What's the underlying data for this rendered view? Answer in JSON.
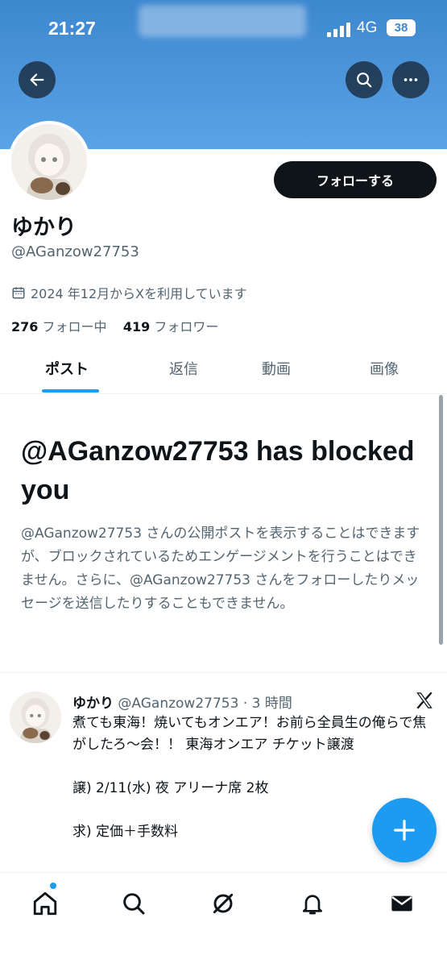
{
  "status_bar": {
    "time": "21:27",
    "network": "4G",
    "battery": "38"
  },
  "header": {
    "back_icon": "arrow-left-icon",
    "search_icon": "search-icon",
    "more_icon": "more-icon"
  },
  "profile": {
    "name": "ゆかり",
    "handle": "@AGanzow27753",
    "joined": "2024 年12月からXを利用しています",
    "following_count": "276",
    "following_label": "フォロー中",
    "followers_count": "419",
    "followers_label": "フォロワー",
    "follow_button": "フォローする"
  },
  "tabs": [
    {
      "label": "ポスト",
      "active": true
    },
    {
      "label": "返信",
      "active": false
    },
    {
      "label": "動画",
      "active": false
    },
    {
      "label": "画像",
      "active": false
    }
  ],
  "blocked": {
    "title": "@AGanzow27753 has blocked you",
    "body": "@AGanzow27753 さんの公開ポストを表示することはできますが、ブロックされているためエンゲージメントを行うことはできません。さらに、@AGanzow27753 さんをフォローしたりメッセージを送信したりすることもできません。"
  },
  "tweet": {
    "name": "ゆかり",
    "meta": "@AGanzow27753 · 3 時間",
    "text": "煮ても東海！焼いてもオンエア！お前ら全員生の俺らで焦がしたろ〜会！！ 東海オンエア チケット譲渡\n\n譲) 2/11(水) 夜 アリーナ席 2枚\n\n求) 定価＋手数料"
  },
  "colors": {
    "accent": "#1d9bf0",
    "banner": "#4a95dc",
    "text": "#0f1419",
    "muted": "#536471"
  }
}
